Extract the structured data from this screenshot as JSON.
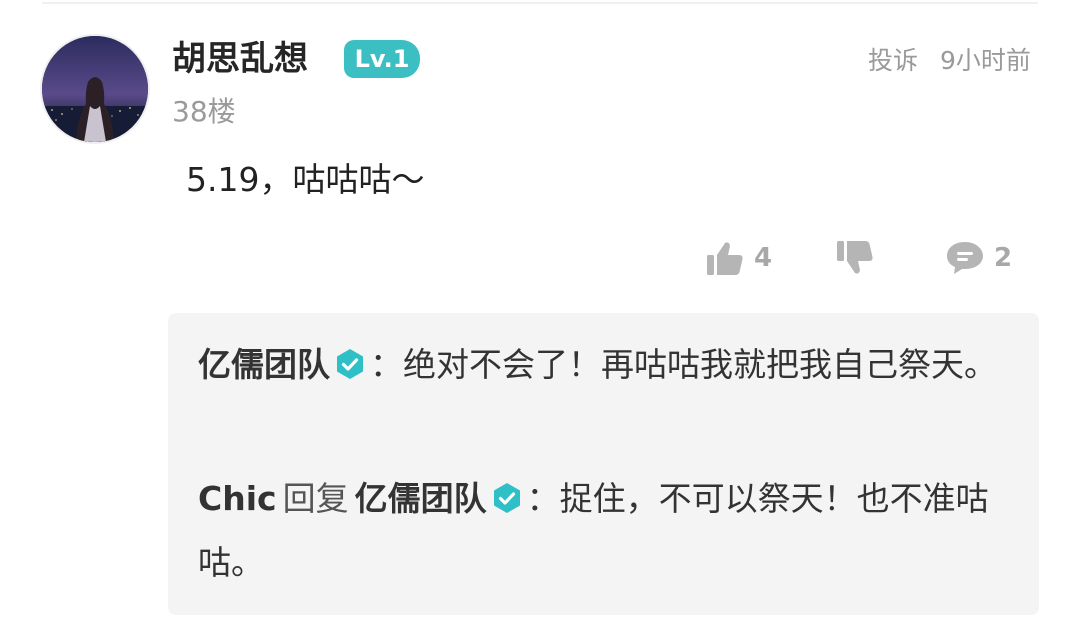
{
  "comment": {
    "username": "胡思乱想",
    "level": "Lv.1",
    "floor": "38楼",
    "report_label": "投诉",
    "time": "9小时前",
    "text": "5.19，咕咕咕～",
    "likes": "4",
    "replies_count": "2",
    "avatar_icon": "avatar-night-city",
    "like_icon": "thumb-up-icon",
    "dislike_icon": "thumb-down-icon",
    "reply_icon": "comment-bubble-icon"
  },
  "replies": [
    {
      "author": "亿儒团队",
      "verified": true,
      "separator": "：",
      "text": "绝对不会了！再咕咕我就把我自己祭天。"
    },
    {
      "author": "Chic",
      "reply_verb": "回复",
      "target": "亿儒团队",
      "target_verified": true,
      "separator": "：",
      "text": "捉住，不可以祭天！也不准咕咕。"
    }
  ],
  "colors": {
    "badge": "#3bbfc2",
    "verify": "#2fbfc6",
    "muted": "#9a9a9a",
    "reply_bg": "#f4f4f4"
  }
}
